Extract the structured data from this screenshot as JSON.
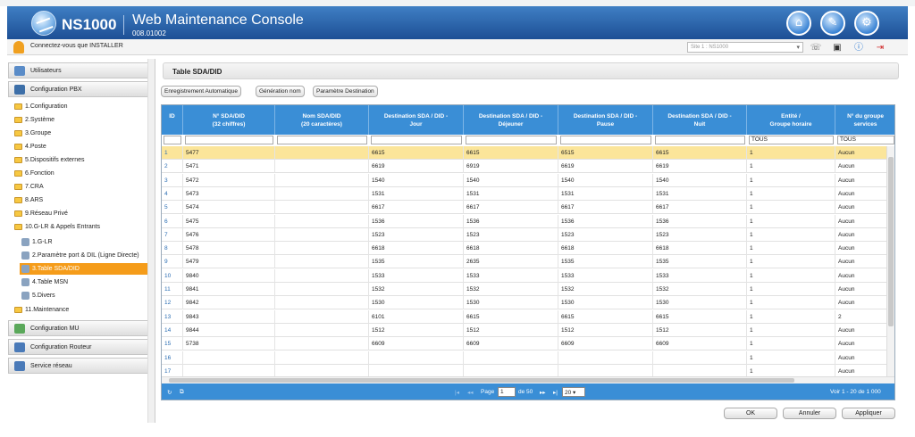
{
  "header": {
    "product": "NS1000",
    "title": "Web Maintenance Console",
    "version": "008.01002"
  },
  "userbar": {
    "login_text": "Connectez-vous que INSTALLER",
    "site": "Site 1 : NS1000"
  },
  "sidebar": {
    "groups": [
      {
        "label": "Utilisateurs",
        "icon": "users-icon",
        "color": "#5a8cc8"
      },
      {
        "label": "Configuration PBX",
        "icon": "pbx-icon",
        "color": "#3d6fa8"
      },
      {
        "label": "Configuration MU",
        "icon": "mu-icon",
        "color": "#5aa85a"
      },
      {
        "label": "Configuration Routeur",
        "icon": "router-icon",
        "color": "#4a7ab8"
      },
      {
        "label": "Service réseau",
        "icon": "network-icon",
        "color": "#4a7ab8"
      }
    ],
    "items": [
      "1.Configuration",
      "2.Système",
      "3.Groupe",
      "4.Poste",
      "5.Dispositifs externes",
      "6.Fonction",
      "7.CRA",
      "8.ARS",
      "9.Réseau Privé",
      "10.G-LR & Appels Entrants"
    ],
    "subitems": [
      "1.G-LR",
      "2.Paramètre port & DIL (Ligne Directe)",
      "3.Table SDA/DID",
      "4.Table MSN",
      "5.Divers"
    ],
    "item_last": "11.Maintenance"
  },
  "main": {
    "page_title": "Table SDA/DID",
    "buttons": [
      "Enregistrement  Automatique",
      "Génération nom",
      "Paramètre Destination"
    ],
    "columns": [
      {
        "line1": "ID",
        "line2": ""
      },
      {
        "line1": "N° SDA/DID",
        "line2": "(32 chiffres)"
      },
      {
        "line1": "Nom SDA/DID",
        "line2": "(20 caractères)"
      },
      {
        "line1": "Destination SDA / DID -",
        "line2": "Jour"
      },
      {
        "line1": "Destination SDA / DID -",
        "line2": "Déjeuner"
      },
      {
        "line1": "Destination SDA / DID -",
        "line2": "Pause"
      },
      {
        "line1": "Destination SDA / DID -",
        "line2": "Nuit"
      },
      {
        "line1": "Entité /",
        "line2": "Groupe horaire"
      },
      {
        "line1": "N° du groupe",
        "line2": "services"
      }
    ],
    "filter_entity": "TOUS",
    "filter_group": "TOUS",
    "rows": [
      {
        "id": "1",
        "num": "5477",
        "name": "",
        "jour": "6615",
        "dej": "6615",
        "pause": "6515",
        "nuit": "6615",
        "entite": "1",
        "groupe": "Aucun"
      },
      {
        "id": "2",
        "num": "5471",
        "name": "",
        "jour": "6619",
        "dej": "6919",
        "pause": "6619",
        "nuit": "6619",
        "entite": "1",
        "groupe": "Aucun"
      },
      {
        "id": "3",
        "num": "5472",
        "name": "",
        "jour": "1540",
        "dej": "1540",
        "pause": "1540",
        "nuit": "1540",
        "entite": "1",
        "groupe": "Aucun"
      },
      {
        "id": "4",
        "num": "5473",
        "name": "",
        "jour": "1531",
        "dej": "1531",
        "pause": "1531",
        "nuit": "1531",
        "entite": "1",
        "groupe": "Aucun"
      },
      {
        "id": "5",
        "num": "5474",
        "name": "",
        "jour": "6617",
        "dej": "6617",
        "pause": "6617",
        "nuit": "6617",
        "entite": "1",
        "groupe": "Aucun"
      },
      {
        "id": "6",
        "num": "5475",
        "name": "",
        "jour": "1536",
        "dej": "1536",
        "pause": "1536",
        "nuit": "1536",
        "entite": "1",
        "groupe": "Aucun"
      },
      {
        "id": "7",
        "num": "5476",
        "name": "",
        "jour": "1523",
        "dej": "1523",
        "pause": "1523",
        "nuit": "1523",
        "entite": "1",
        "groupe": "Aucun"
      },
      {
        "id": "8",
        "num": "5478",
        "name": "",
        "jour": "6618",
        "dej": "6618",
        "pause": "6618",
        "nuit": "6618",
        "entite": "1",
        "groupe": "Aucun"
      },
      {
        "id": "9",
        "num": "5479",
        "name": "",
        "jour": "1535",
        "dej": "2635",
        "pause": "1535",
        "nuit": "1535",
        "entite": "1",
        "groupe": "Aucun"
      },
      {
        "id": "10",
        "num": "9840",
        "name": "",
        "jour": "1533",
        "dej": "1533",
        "pause": "1533",
        "nuit": "1533",
        "entite": "1",
        "groupe": "Aucun"
      },
      {
        "id": "11",
        "num": "9841",
        "name": "",
        "jour": "1532",
        "dej": "1532",
        "pause": "1532",
        "nuit": "1532",
        "entite": "1",
        "groupe": "Aucun"
      },
      {
        "id": "12",
        "num": "9842",
        "name": "",
        "jour": "1530",
        "dej": "1530",
        "pause": "1530",
        "nuit": "1530",
        "entite": "1",
        "groupe": "Aucun"
      },
      {
        "id": "13",
        "num": "9843",
        "name": "",
        "jour": "6101",
        "dej": "6615",
        "pause": "6615",
        "nuit": "6615",
        "entite": "1",
        "groupe": "2"
      },
      {
        "id": "14",
        "num": "9844",
        "name": "",
        "jour": "1512",
        "dej": "1512",
        "pause": "1512",
        "nuit": "1512",
        "entite": "1",
        "groupe": "Aucun"
      },
      {
        "id": "15",
        "num": "5738",
        "name": "",
        "jour": "6609",
        "dej": "6609",
        "pause": "6609",
        "nuit": "6609",
        "entite": "1",
        "groupe": "Aucun"
      },
      {
        "id": "16",
        "num": "",
        "name": "",
        "jour": "",
        "dej": "",
        "pause": "",
        "nuit": "",
        "entite": "1",
        "groupe": "Aucun"
      },
      {
        "id": "17",
        "num": "",
        "name": "",
        "jour": "",
        "dej": "",
        "pause": "",
        "nuit": "",
        "entite": "1",
        "groupe": "Aucun"
      }
    ],
    "pager": {
      "page_label": "Page",
      "page_value": "1",
      "of_label": "de 50",
      "page_size": "20",
      "summary": "Voir 1 - 20 de 1 000"
    },
    "footer": {
      "ok": "OK",
      "cancel": "Annuler",
      "apply": "Appliquer"
    }
  },
  "colors": {
    "header": "#1d4f95",
    "grid_header": "#3a8ed6",
    "selected_row": "#fbe59a",
    "active_nav": "#f59c1a"
  }
}
